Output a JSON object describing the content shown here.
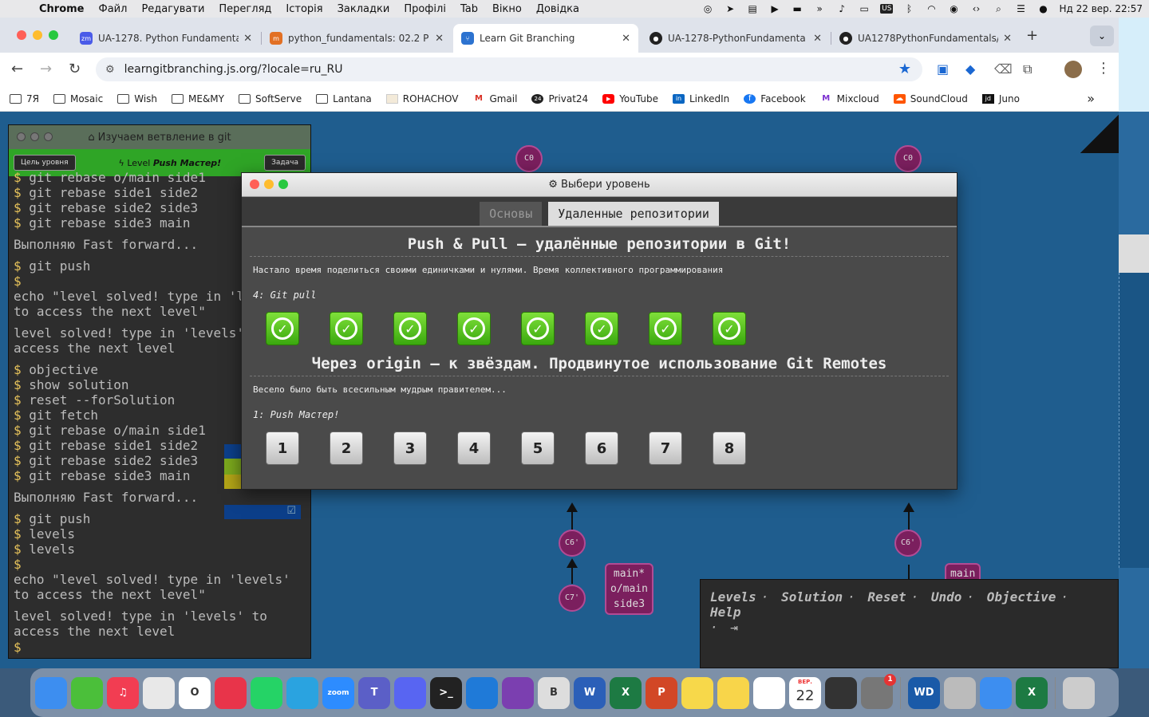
{
  "menubar": {
    "app": "Chrome",
    "items": [
      "Файл",
      "Редагувати",
      "Перегляд",
      "Історія",
      "Закладки",
      "Профілі",
      "Tab",
      "Вікно",
      "Довідка"
    ],
    "input_source": "US",
    "datetime": "Нд 22 вер.  22:57"
  },
  "tabs": [
    {
      "title": "UA-1278. Python Fundamenta",
      "favicon": "zoom-icon",
      "fav_text": "zm",
      "color": "#4a5be8"
    },
    {
      "title": "python_fundamentals: 02.2 P",
      "favicon": "gitlab-icon",
      "fav_text": "m",
      "color": "#e27024"
    },
    {
      "title": "Learn Git Branching",
      "favicon": "git-branching-icon",
      "fav_text": "",
      "color": "#2d73d0",
      "active": true
    },
    {
      "title": "UA-1278-PythonFundamenta",
      "favicon": "github-icon",
      "fav_text": "",
      "color": "#222"
    },
    {
      "title": "UA1278PythonFundamentals/",
      "favicon": "github-icon",
      "fav_text": "",
      "color": "#222"
    }
  ],
  "address": {
    "url": "learngitbranching.js.org/?locale=ru_RU"
  },
  "bookmarks": [
    {
      "label": "7Я",
      "icon": "folder-icon"
    },
    {
      "label": "Mosaic",
      "icon": "folder-icon"
    },
    {
      "label": "Wish",
      "icon": "folder-icon"
    },
    {
      "label": "ME&MY",
      "icon": "folder-icon"
    },
    {
      "label": "SoftServe",
      "icon": "folder-icon"
    },
    {
      "label": "Lantana",
      "icon": "folder-icon"
    },
    {
      "label": "ROHACHOV",
      "icon": "page-icon"
    },
    {
      "label": "Gmail",
      "icon": "gmail-icon"
    },
    {
      "label": "Privat24",
      "icon": "privat24-icon"
    },
    {
      "label": "YouTube",
      "icon": "youtube-icon"
    },
    {
      "label": "LinkedIn",
      "icon": "linkedin-icon"
    },
    {
      "label": "Facebook",
      "icon": "facebook-icon"
    },
    {
      "label": "Mixcloud",
      "icon": "mixcloud-icon"
    },
    {
      "label": "SoundCloud",
      "icon": "soundcloud-icon"
    },
    {
      "label": "Juno",
      "icon": "juno-icon"
    }
  ],
  "terminal": {
    "title": "Изучаем ветвление в git",
    "goal_button": "Цель уровня",
    "level_prefix": "Level",
    "level_name": "Push Мастер!",
    "task_button": "Задача",
    "lines": [
      {
        "kind": "cmd",
        "text": "git rebase o/main side1"
      },
      {
        "kind": "cmd",
        "text": "git rebase side1 side2"
      },
      {
        "kind": "cmd",
        "text": "git rebase side2 side3"
      },
      {
        "kind": "cmd",
        "text": "git rebase side3 main"
      },
      {
        "kind": "out",
        "text": "Выполняю Fast forward..."
      },
      {
        "kind": "cmd",
        "text": "git push"
      },
      {
        "kind": "cmd",
        "text": "echo \"level solved! type in 'levels'"
      },
      {
        "kind": "cont",
        "text": "to access the next level\""
      },
      {
        "kind": "out",
        "text": "level solved! type in 'levels' to\naccess the next level"
      },
      {
        "kind": "cmd",
        "text": "objective"
      },
      {
        "kind": "cmd",
        "text": "show solution"
      },
      {
        "kind": "cmd",
        "text": "reset --forSolution"
      },
      {
        "kind": "cmd",
        "text": "git fetch"
      },
      {
        "kind": "cmd",
        "text": "git rebase o/main side1"
      },
      {
        "kind": "cmd",
        "text": "git rebase side1 side2"
      },
      {
        "kind": "cmd",
        "text": "git rebase side2 side3"
      },
      {
        "kind": "cmd",
        "text": "git rebase side3 main"
      },
      {
        "kind": "out",
        "text": "Выполняю Fast forward..."
      },
      {
        "kind": "cmd",
        "text": "git push"
      },
      {
        "kind": "cmd",
        "text": "levels"
      },
      {
        "kind": "cmd",
        "text": "levels"
      },
      {
        "kind": "cmd",
        "text": "echo \"level solved! type in 'levels'"
      },
      {
        "kind": "cont",
        "text": "to access the next level\""
      },
      {
        "kind": "out",
        "text": "level solved! type in 'levels' to\naccess the next level"
      }
    ],
    "prompt": "$"
  },
  "tree": {
    "left_root": "C0",
    "right_root": "C0",
    "left_c6": "C6'",
    "left_c7": "C7'",
    "right_c6": "C6'",
    "left_label": "main*\no/main\nside3",
    "right_label": "main"
  },
  "commands": {
    "items": [
      "Levels",
      "Solution",
      "Reset",
      "Undo",
      "Objective",
      "Help"
    ],
    "separator": "·"
  },
  "modal": {
    "title": "Выбери уровень",
    "tab_basic": "Основы",
    "tab_remote": "Удаленные репозитории",
    "seq1": {
      "title": "Push & Pull – удалённые репозитории в Git!",
      "desc": "Настало время поделиться своими единичками и нулями. Время коллективного программирования",
      "current": "4: Git pull",
      "levels": [
        "done",
        "done",
        "done",
        "done",
        "done",
        "done",
        "done",
        "done"
      ]
    },
    "seq2": {
      "title": "Через origin – к звёздам. Продвинутое использование Git Remotes",
      "desc": "Весело было быть всесильным мудрым правителем...",
      "current": "1: Push Мастер!",
      "levels": [
        "1",
        "2",
        "3",
        "4",
        "5",
        "6",
        "7",
        "8"
      ]
    }
  },
  "dock": {
    "apps": [
      {
        "name": "finder-icon",
        "color": "#3d8ef0",
        "label": ""
      },
      {
        "name": "remote-desktop-icon",
        "color": "#4bbf3a",
        "label": ""
      },
      {
        "name": "music-icon",
        "color": "#f23d52",
        "label": "♫"
      },
      {
        "name": "chrome-icon",
        "color": "#e8e8e8",
        "label": ""
      },
      {
        "name": "opera-icon",
        "color": "#fff",
        "label": "O"
      },
      {
        "name": "lips-icon",
        "color": "#e8344a",
        "label": ""
      },
      {
        "name": "whatsapp-icon",
        "color": "#25d366",
        "label": ""
      },
      {
        "name": "telegram-icon",
        "color": "#2aa3e0",
        "label": ""
      },
      {
        "name": "zoom-icon",
        "color": "#2d8cff",
        "label": "zoom"
      },
      {
        "name": "teams-icon",
        "color": "#5b5fc7",
        "label": "T"
      },
      {
        "name": "discord-icon",
        "color": "#5865f2",
        "label": ""
      },
      {
        "name": "terminal-icon",
        "color": "#222",
        "label": ">_"
      },
      {
        "name": "vscode-icon",
        "color": "#1f7ad8",
        "label": ""
      },
      {
        "name": "github-desktop-icon",
        "color": "#7b3fb0",
        "label": ""
      },
      {
        "name": "bbedit-icon",
        "color": "#ddd",
        "label": "B"
      },
      {
        "name": "word-icon",
        "color": "#2b5fb8",
        "label": "W"
      },
      {
        "name": "excel-icon",
        "color": "#1d7a43",
        "label": "X"
      },
      {
        "name": "powerpoint-icon",
        "color": "#d24726",
        "label": "P"
      },
      {
        "name": "stickies-icon",
        "color": "#f7d84a",
        "label": ""
      },
      {
        "name": "notes-icon",
        "color": "#f8d54a",
        "label": ""
      },
      {
        "name": "reminders-icon",
        "color": "#fff",
        "label": ""
      },
      {
        "name": "calendar-icon",
        "color": "#fff",
        "label": "22",
        "month": "ВЕР."
      },
      {
        "name": "calculator-icon",
        "color": "#333",
        "label": ""
      },
      {
        "name": "system-settings-icon",
        "color": "#777",
        "label": "",
        "badge": "1"
      },
      {
        "name": "wd-drive-icon",
        "color": "#1a5aa8",
        "label": "WD"
      },
      {
        "name": "preview-icon",
        "color": "#bbb",
        "label": ""
      },
      {
        "name": "mail-icon",
        "color": "#3d8ef0",
        "label": ""
      },
      {
        "name": "excel-file-icon",
        "color": "#1d7a43",
        "label": "X"
      },
      {
        "name": "trash-icon",
        "color": "#ccc",
        "label": ""
      }
    ]
  }
}
